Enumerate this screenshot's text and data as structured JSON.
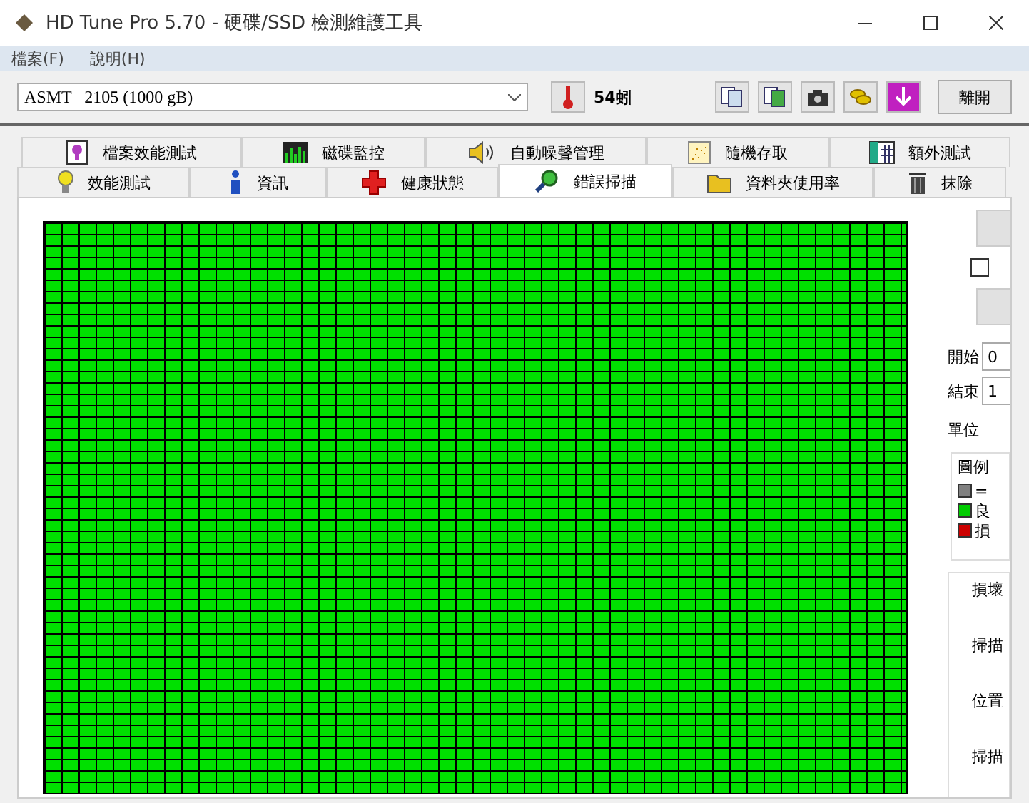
{
  "window": {
    "title": "HD Tune Pro 5.70 - 硬碟/SSD 檢測維護工具"
  },
  "menu": [
    "檔案(F)",
    "說明(H)"
  ],
  "toolbar": {
    "drive": "ASMT   2105 (1000 gB)",
    "temperature": "54蚓",
    "exit_button": "離開"
  },
  "tabs_top": [
    {
      "label": "檔案效能測試",
      "selected": false
    },
    {
      "label": "磁碟監控",
      "selected": false
    },
    {
      "label": "自動噪聲管理",
      "selected": false
    },
    {
      "label": "隨機存取",
      "selected": false
    },
    {
      "label": "額外測試",
      "selected": false
    }
  ],
  "tabs_bottom": [
    {
      "label": "效能測試",
      "selected": false
    },
    {
      "label": "資訊",
      "selected": false
    },
    {
      "label": "健康狀態",
      "selected": false
    },
    {
      "label": "錯誤掃描",
      "selected": true
    },
    {
      "label": "資料夾使用率",
      "selected": false
    },
    {
      "label": "抹除",
      "selected": false
    }
  ],
  "side": {
    "quick_scan_checked": false,
    "start_label": "開始",
    "start_value": "0",
    "end_label": "結束",
    "end_value": "1",
    "unit_label": "單位",
    "legend_title": "圖例",
    "legend": [
      {
        "label": "=",
        "color": "#808080"
      },
      {
        "label": "良",
        "color": "#00cc00"
      },
      {
        "label": "損",
        "color": "#cc0000"
      }
    ],
    "stats": [
      "損壞",
      "掃描",
      "位置",
      "掃描"
    ]
  }
}
